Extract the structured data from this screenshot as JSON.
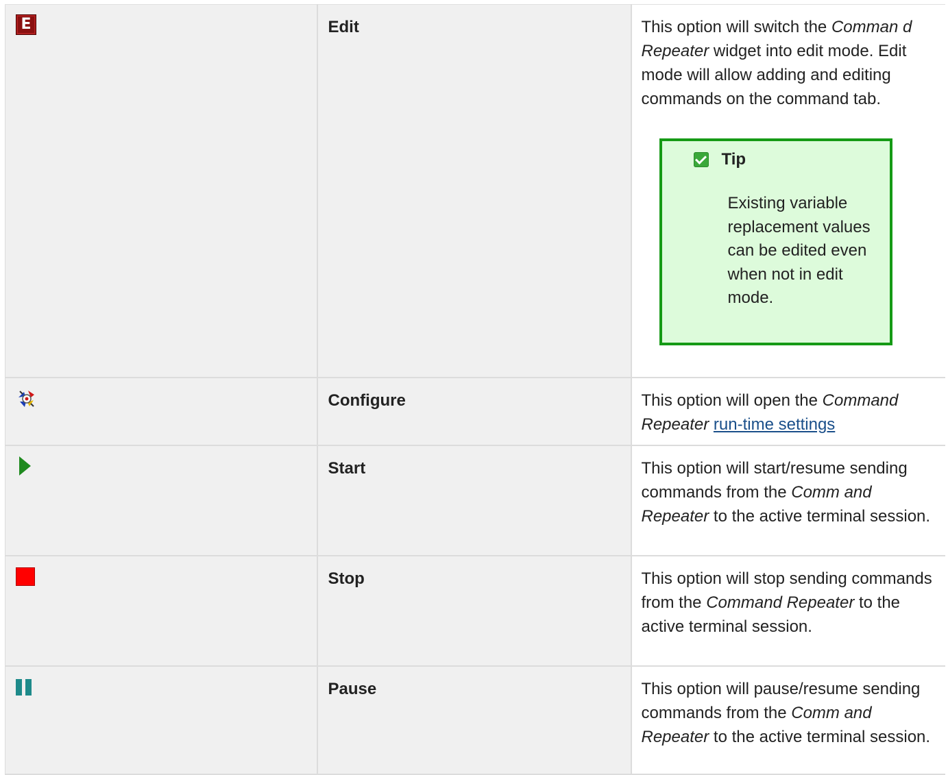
{
  "rows": [
    {
      "icon": "edit-icon",
      "name": "Edit",
      "desc": {
        "t1": "This option will switch the ",
        "i1": "Comman d Repeater",
        "t2": " widget into edit mode. Edit mode will allow adding and editing commands on the command tab."
      },
      "tip": {
        "icon": "check-icon",
        "title": "Tip",
        "body": "Existing variable replacement values can be edited even when not in edit mode."
      }
    },
    {
      "icon": "configure-icon",
      "name": "Configure",
      "desc": {
        "t1": "This option will open the ",
        "i1": "Command Repeater",
        "t2": " ",
        "link": "run-time settings"
      }
    },
    {
      "icon": "start-icon",
      "name": "Start",
      "desc": {
        "t1": "This option will start/resume sending commands from the ",
        "i1": "Comm and Repeater",
        "t2": " to the active terminal session."
      }
    },
    {
      "icon": "stop-icon",
      "name": "Stop",
      "desc": {
        "t1": "This option will stop sending commands from the ",
        "i1": "Command Repeater",
        "t2": " to the active terminal session."
      }
    },
    {
      "icon": "pause-icon",
      "name": "Pause",
      "desc": {
        "t1": "This option will pause/resume sending commands from the ",
        "i1": "Comm and Repeater",
        "t2": " to the active terminal session."
      }
    }
  ],
  "colors": {
    "cell_gray": "#f0f0f0",
    "border": "#dcdcdc",
    "tip_bg": "#ddfbdb",
    "tip_border": "#159a15",
    "link": "#1a4f8a",
    "edit_icon": "#8b1010",
    "start_icon": "#1f8a1f",
    "stop_icon": "#ff0000",
    "pause_icon": "#1e8a8a"
  }
}
